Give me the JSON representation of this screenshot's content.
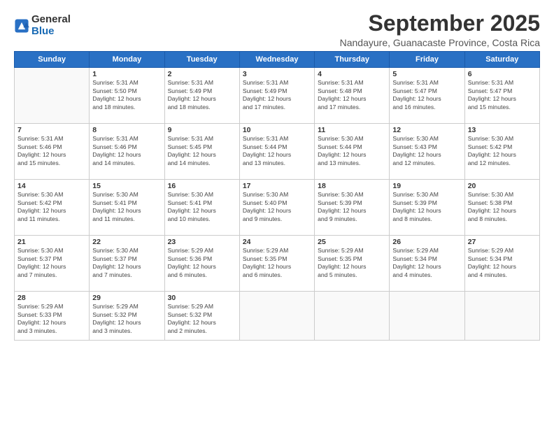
{
  "logo": {
    "general": "General",
    "blue": "Blue"
  },
  "title": "September 2025",
  "location": "Nandayure, Guanacaste Province, Costa Rica",
  "days_of_week": [
    "Sunday",
    "Monday",
    "Tuesday",
    "Wednesday",
    "Thursday",
    "Friday",
    "Saturday"
  ],
  "weeks": [
    [
      {
        "day": "",
        "info": ""
      },
      {
        "day": "1",
        "info": "Sunrise: 5:31 AM\nSunset: 5:50 PM\nDaylight: 12 hours\nand 18 minutes."
      },
      {
        "day": "2",
        "info": "Sunrise: 5:31 AM\nSunset: 5:49 PM\nDaylight: 12 hours\nand 18 minutes."
      },
      {
        "day": "3",
        "info": "Sunrise: 5:31 AM\nSunset: 5:49 PM\nDaylight: 12 hours\nand 17 minutes."
      },
      {
        "day": "4",
        "info": "Sunrise: 5:31 AM\nSunset: 5:48 PM\nDaylight: 12 hours\nand 17 minutes."
      },
      {
        "day": "5",
        "info": "Sunrise: 5:31 AM\nSunset: 5:47 PM\nDaylight: 12 hours\nand 16 minutes."
      },
      {
        "day": "6",
        "info": "Sunrise: 5:31 AM\nSunset: 5:47 PM\nDaylight: 12 hours\nand 15 minutes."
      }
    ],
    [
      {
        "day": "7",
        "info": "Sunrise: 5:31 AM\nSunset: 5:46 PM\nDaylight: 12 hours\nand 15 minutes."
      },
      {
        "day": "8",
        "info": "Sunrise: 5:31 AM\nSunset: 5:46 PM\nDaylight: 12 hours\nand 14 minutes."
      },
      {
        "day": "9",
        "info": "Sunrise: 5:31 AM\nSunset: 5:45 PM\nDaylight: 12 hours\nand 14 minutes."
      },
      {
        "day": "10",
        "info": "Sunrise: 5:31 AM\nSunset: 5:44 PM\nDaylight: 12 hours\nand 13 minutes."
      },
      {
        "day": "11",
        "info": "Sunrise: 5:30 AM\nSunset: 5:44 PM\nDaylight: 12 hours\nand 13 minutes."
      },
      {
        "day": "12",
        "info": "Sunrise: 5:30 AM\nSunset: 5:43 PM\nDaylight: 12 hours\nand 12 minutes."
      },
      {
        "day": "13",
        "info": "Sunrise: 5:30 AM\nSunset: 5:42 PM\nDaylight: 12 hours\nand 12 minutes."
      }
    ],
    [
      {
        "day": "14",
        "info": "Sunrise: 5:30 AM\nSunset: 5:42 PM\nDaylight: 12 hours\nand 11 minutes."
      },
      {
        "day": "15",
        "info": "Sunrise: 5:30 AM\nSunset: 5:41 PM\nDaylight: 12 hours\nand 11 minutes."
      },
      {
        "day": "16",
        "info": "Sunrise: 5:30 AM\nSunset: 5:41 PM\nDaylight: 12 hours\nand 10 minutes."
      },
      {
        "day": "17",
        "info": "Sunrise: 5:30 AM\nSunset: 5:40 PM\nDaylight: 12 hours\nand 9 minutes."
      },
      {
        "day": "18",
        "info": "Sunrise: 5:30 AM\nSunset: 5:39 PM\nDaylight: 12 hours\nand 9 minutes."
      },
      {
        "day": "19",
        "info": "Sunrise: 5:30 AM\nSunset: 5:39 PM\nDaylight: 12 hours\nand 8 minutes."
      },
      {
        "day": "20",
        "info": "Sunrise: 5:30 AM\nSunset: 5:38 PM\nDaylight: 12 hours\nand 8 minutes."
      }
    ],
    [
      {
        "day": "21",
        "info": "Sunrise: 5:30 AM\nSunset: 5:37 PM\nDaylight: 12 hours\nand 7 minutes."
      },
      {
        "day": "22",
        "info": "Sunrise: 5:30 AM\nSunset: 5:37 PM\nDaylight: 12 hours\nand 7 minutes."
      },
      {
        "day": "23",
        "info": "Sunrise: 5:29 AM\nSunset: 5:36 PM\nDaylight: 12 hours\nand 6 minutes."
      },
      {
        "day": "24",
        "info": "Sunrise: 5:29 AM\nSunset: 5:35 PM\nDaylight: 12 hours\nand 6 minutes."
      },
      {
        "day": "25",
        "info": "Sunrise: 5:29 AM\nSunset: 5:35 PM\nDaylight: 12 hours\nand 5 minutes."
      },
      {
        "day": "26",
        "info": "Sunrise: 5:29 AM\nSunset: 5:34 PM\nDaylight: 12 hours\nand 4 minutes."
      },
      {
        "day": "27",
        "info": "Sunrise: 5:29 AM\nSunset: 5:34 PM\nDaylight: 12 hours\nand 4 minutes."
      }
    ],
    [
      {
        "day": "28",
        "info": "Sunrise: 5:29 AM\nSunset: 5:33 PM\nDaylight: 12 hours\nand 3 minutes."
      },
      {
        "day": "29",
        "info": "Sunrise: 5:29 AM\nSunset: 5:32 PM\nDaylight: 12 hours\nand 3 minutes."
      },
      {
        "day": "30",
        "info": "Sunrise: 5:29 AM\nSunset: 5:32 PM\nDaylight: 12 hours\nand 2 minutes."
      },
      {
        "day": "",
        "info": ""
      },
      {
        "day": "",
        "info": ""
      },
      {
        "day": "",
        "info": ""
      },
      {
        "day": "",
        "info": ""
      }
    ]
  ]
}
